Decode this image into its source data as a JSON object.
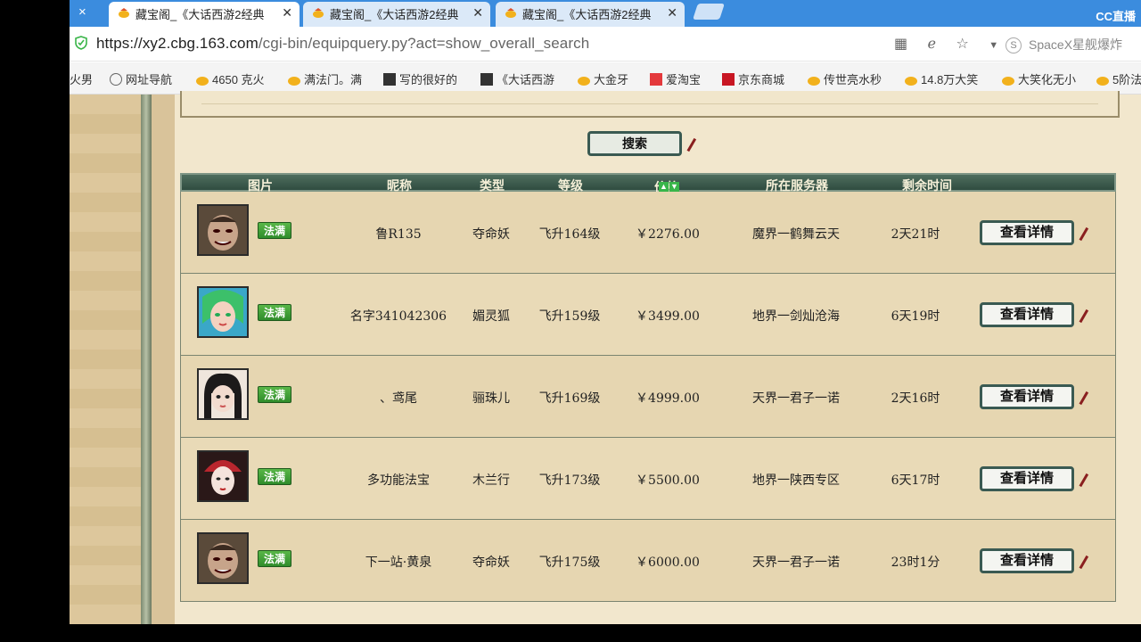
{
  "browser": {
    "lead_close": "×",
    "tabs": [
      {
        "title": "藏宝阁_《大话西游2经典",
        "active": true
      },
      {
        "title": "藏宝阁_《大话西游2经典",
        "active": false
      },
      {
        "title": "藏宝阁_《大话西游2经典",
        "active": false
      }
    ],
    "watermark": "CC直播",
    "url_host": "https://xy2.cbg.163.com",
    "url_path": "/cgi-bin/equipquery.py?act=show_overall_search",
    "side_search": "SpaceX星舰爆炸",
    "side_search_icon": "S",
    "bookmarks": [
      {
        "label": "火男",
        "icon": "none"
      },
      {
        "label": "网址导航",
        "icon": "globe-icon"
      },
      {
        "label": "4650 克火",
        "icon": "cbg-icon"
      },
      {
        "label": "满法门。满",
        "icon": "cbg-icon"
      },
      {
        "label": "写的很好的",
        "icon": "page-icon"
      },
      {
        "label": "《大话西游",
        "icon": "page-icon"
      },
      {
        "label": "大金牙",
        "icon": "cbg-icon"
      },
      {
        "label": "爱淘宝",
        "icon": "taobao-icon"
      },
      {
        "label": "京东商城",
        "icon": "jd-icon"
      },
      {
        "label": "传世亮水秒",
        "icon": "cbg-icon"
      },
      {
        "label": "14.8万大笑",
        "icon": "cbg-icon"
      },
      {
        "label": "大笑化无小",
        "icon": "cbg-icon"
      },
      {
        "label": "5阶法",
        "icon": "cbg-icon"
      }
    ]
  },
  "page": {
    "search_label": "搜索",
    "headers": {
      "image": "图片",
      "nickname": "昵称",
      "type": "类型",
      "level": "等级",
      "price": "价格",
      "server": "所在服务器",
      "time_left": "剩余时间"
    },
    "badge_label": "法满",
    "detail_label": "查看详情",
    "rows": [
      {
        "nickname": "鲁R135",
        "type": "夺命妖",
        "level": "飞升164级",
        "price": "￥2276.00",
        "server": "魔界一鹤舞云天",
        "time_left": "2天21时",
        "avatar": "demon"
      },
      {
        "nickname": "名字341042306",
        "type": "媚灵狐",
        "level": "飞升159级",
        "price": "￥3499.00",
        "server": "地界一剑灿沧海",
        "time_left": "6天19时",
        "avatar": "fox"
      },
      {
        "nickname": "、鸢尾",
        "type": "骊珠儿",
        "level": "飞升169级",
        "price": "￥4999.00",
        "server": "天界一君子一诺",
        "time_left": "2天16时",
        "avatar": "girl"
      },
      {
        "nickname": "多功能法宝",
        "type": "木兰行",
        "level": "飞升173级",
        "price": "￥5500.00",
        "server": "地界一陕西专区",
        "time_left": "6天17时",
        "avatar": "lady"
      },
      {
        "nickname": "下一站·黄泉",
        "type": "夺命妖",
        "level": "飞升175级",
        "price": "￥6000.00",
        "server": "天界一君子一诺",
        "time_left": "23时1分",
        "avatar": "demon"
      }
    ],
    "colors": {
      "header": "#3d5c4f",
      "badge": "#3fa23a",
      "accent_red": "#8a1f1f"
    }
  }
}
